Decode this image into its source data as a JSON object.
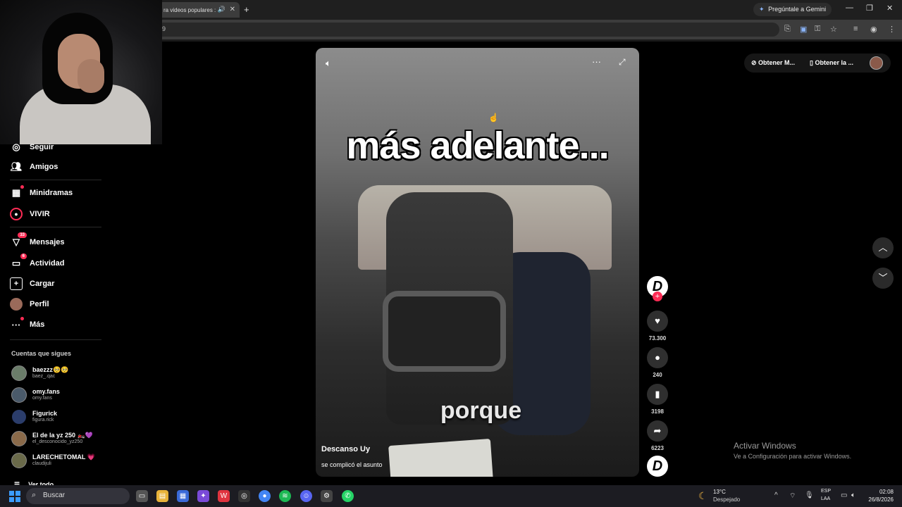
{
  "browser": {
    "tab_title": "ra videos populares :",
    "tab_audio_icon": "speaker-icon",
    "new_tab": "+",
    "gemini_label": "Pregúntale a Gemini",
    "url_fragment": "9",
    "window_controls": [
      "—",
      "❐",
      "✕"
    ]
  },
  "sidebar": {
    "items": [
      {
        "label": "Seguir",
        "icon": "following-icon",
        "top": 0
      },
      {
        "label": "Amigos",
        "icon": "friends-icon"
      },
      {
        "label": "Minidramas",
        "icon": "minidramas-icon"
      },
      {
        "label": "VIVIR",
        "icon": "live-icon"
      },
      {
        "label": "Mensajes",
        "icon": "messages-icon",
        "badge": "33"
      },
      {
        "label": "Actividad",
        "icon": "activity-icon",
        "badge": "6"
      },
      {
        "label": "Cargar",
        "icon": "upload-icon"
      },
      {
        "label": "Perfil",
        "icon": "profile-icon"
      },
      {
        "label": "Más",
        "icon": "more-icon"
      }
    ],
    "following_title": "Cuentas que sigues",
    "accounts": [
      {
        "name": "baezzz🥺🥺",
        "user": "baez_.qac"
      },
      {
        "name": "omy.fans",
        "user": "omy.fans"
      },
      {
        "name": "Figurick",
        "user": "figura.rick"
      },
      {
        "name": "El de la yz 250 🏍️💜",
        "user": "el_desconocido_yz250"
      },
      {
        "name": "LARECHETOMAL 💗",
        "user": "claudijuli"
      }
    ],
    "see_all": "Ver todo"
  },
  "video": {
    "caption_top": "más adelante...",
    "caption_bottom": "porque",
    "author": "Descanso Uy",
    "description": "se complicó el asunto"
  },
  "actions": {
    "likes": "73.300",
    "comments": "240",
    "saves": "3198",
    "shares": "6223"
  },
  "top_right": {
    "get_app_1": "Obtener M...",
    "get_app_2": "Obtener la ..."
  },
  "watermark": {
    "line1": "Activar Windows",
    "line2": "Ve a Configuración para activar Windows."
  },
  "taskbar": {
    "search_placeholder": "Buscar",
    "temp": "13°C",
    "condition": "Despejado",
    "lang1": "ESP",
    "lang2": "LAA",
    "time": "02:08",
    "date": "26/8/2026"
  }
}
